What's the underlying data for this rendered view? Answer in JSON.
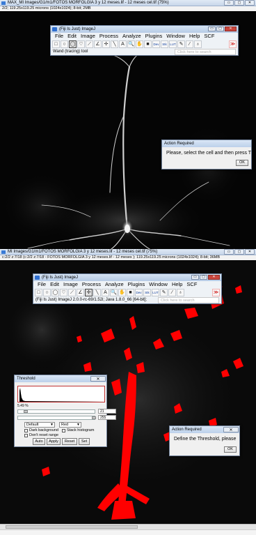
{
  "top_window": {
    "title": "MAX_MI Images/G1/m1/FOTOS MORFOLGIA 3 y 12 meses.lif - 12  meses cel.tif (75%)",
    "info": "2/2; 119.25x119.25 microns (1024x1024); 8-bit; 2MB"
  },
  "bottom_window": {
    "title": "MI Images/G1/m1/FOTOS MORFOLGIA 3 y 12 meses.lif - 12  meses cel.tif (75%)",
    "info": "c:2/2 z:7/18 (c:2/2 z:7/18 - FOTOS MORFOLGIA 3 y 12 meses.lif - 12  meses ); 119.25x119.25 microns (1024x1024); 8-bit; 36MB"
  },
  "fiji_top": {
    "title": "(Fiji Is Just) ImageJ",
    "menu": [
      "File",
      "Edit",
      "Image",
      "Process",
      "Analyze",
      "Plugins",
      "Window",
      "Help",
      "SCF"
    ],
    "status": "Wand (tracing) tool",
    "search_placeholder": "Click here to search"
  },
  "fiji_bottom": {
    "title": "(Fiji Is Just) ImageJ",
    "menu": [
      "File",
      "Edit",
      "Image",
      "Process",
      "Analyze",
      "Plugins",
      "Window",
      "Help",
      "SCF"
    ],
    "status": "(Fiji Is Just) ImageJ 2.0.0-rc-69/1.52i; Java 1.8.0_66 [64-bit];",
    "search_placeholder": "Click here to search"
  },
  "toolbar_glyphs": [
    "□",
    "○",
    "◯",
    "♡",
    "⟋",
    "∠",
    "✢",
    "╲",
    "A",
    "🔍",
    "✋",
    "■",
    "Dev",
    "Stk",
    "LUT",
    "✎",
    "⁄",
    "♁"
  ],
  "more_glyph": "≫",
  "action_top": {
    "title": "Action Required",
    "message": "Please, select the cell and then press T",
    "ok": "OK"
  },
  "action_bottom": {
    "title": "Action Required",
    "message": "Define the Threshold, please",
    "ok": "OK"
  },
  "threshold": {
    "title": "Threshold",
    "percent": "5.49 %",
    "min_value": "21",
    "max_value": "255",
    "method": "Default",
    "display": "Red",
    "checks": [
      "Dark background",
      "Stack histogram",
      "Don't reset range"
    ],
    "buttons": [
      "Auto",
      "Apply",
      "Reset",
      "Set"
    ],
    "min_level": 0.08,
    "max_level": 1.0
  },
  "colors": {
    "threshold_red": "#ff0000",
    "close_red": "#c9463d",
    "titlebar_blue": "#bcd0ea"
  },
  "window_buttons": [
    "▭",
    "▢",
    "✕"
  ],
  "close_glyph": "✕"
}
